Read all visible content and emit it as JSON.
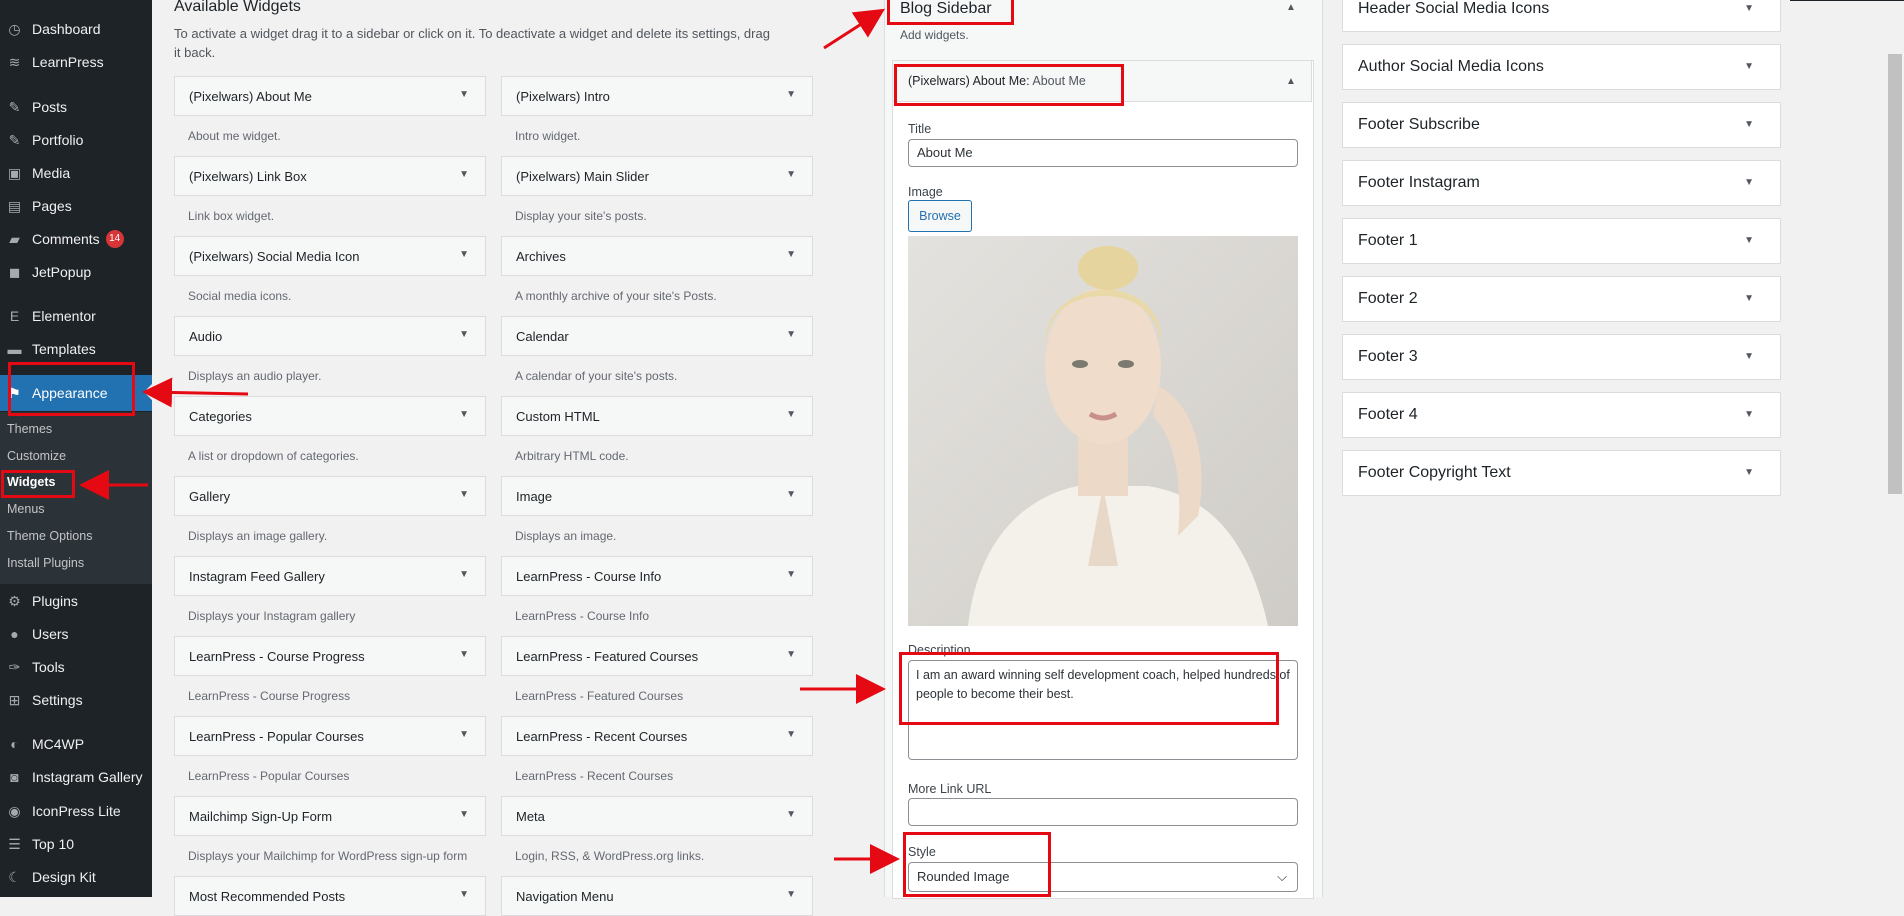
{
  "admin_menu": {
    "items": [
      {
        "label": "Dashboard",
        "icon": "dashboard-icon"
      },
      {
        "label": "LearnPress",
        "icon": "learnpress-icon"
      },
      {
        "label": "Posts",
        "icon": "pin-icon"
      },
      {
        "label": "Portfolio",
        "icon": "pin-icon"
      },
      {
        "label": "Media",
        "icon": "media-icon"
      },
      {
        "label": "Pages",
        "icon": "pages-icon"
      },
      {
        "label": "Comments",
        "icon": "comment-icon",
        "badge": "14"
      },
      {
        "label": "JetPopup",
        "icon": "jetpopup-icon"
      },
      {
        "label": "Elementor",
        "icon": "elementor-icon"
      },
      {
        "label": "Templates",
        "icon": "folder-icon"
      },
      {
        "label": "Appearance",
        "icon": "brush-icon",
        "current": true
      },
      {
        "label": "Plugins",
        "icon": "plugin-icon"
      },
      {
        "label": "Users",
        "icon": "users-icon"
      },
      {
        "label": "Tools",
        "icon": "wrench-icon"
      },
      {
        "label": "Settings",
        "icon": "settings-icon"
      },
      {
        "label": "MC4WP",
        "icon": "mc4wp-icon"
      },
      {
        "label": "Instagram Gallery",
        "icon": "camera-icon"
      },
      {
        "label": "IconPress Lite",
        "icon": "iconpress-icon"
      },
      {
        "label": "Top 10",
        "icon": "list-icon"
      },
      {
        "label": "Design Kit",
        "icon": "moon-icon"
      }
    ],
    "submenu": [
      {
        "label": "Themes"
      },
      {
        "label": "Customize"
      },
      {
        "label": "Widgets",
        "active": true
      },
      {
        "label": "Menus"
      },
      {
        "label": "Theme Options"
      },
      {
        "label": "Install Plugins"
      }
    ]
  },
  "available_widgets": {
    "title": "Available Widgets",
    "description": "To activate a widget drag it to a sidebar or click on it. To deactivate a widget and delete its settings, drag it back.",
    "widgets": [
      {
        "name": "(Pixelwars) About Me",
        "desc": "About me widget."
      },
      {
        "name": "(Pixelwars) Intro",
        "desc": "Intro widget."
      },
      {
        "name": "(Pixelwars) Link Box",
        "desc": "Link box widget."
      },
      {
        "name": "(Pixelwars) Main Slider",
        "desc": "Display your site's posts."
      },
      {
        "name": "(Pixelwars) Social Media Icon",
        "desc": "Social media icons."
      },
      {
        "name": "Archives",
        "desc": "A monthly archive of your site's Posts."
      },
      {
        "name": "Audio",
        "desc": "Displays an audio player."
      },
      {
        "name": "Calendar",
        "desc": "A calendar of your site's posts."
      },
      {
        "name": "Categories",
        "desc": "A list or dropdown of categories."
      },
      {
        "name": "Custom HTML",
        "desc": "Arbitrary HTML code."
      },
      {
        "name": "Gallery",
        "desc": "Displays an image gallery."
      },
      {
        "name": "Image",
        "desc": "Displays an image."
      },
      {
        "name": "Instagram Feed Gallery",
        "desc": "Displays your Instagram gallery"
      },
      {
        "name": "LearnPress - Course Info",
        "desc": "LearnPress - Course Info"
      },
      {
        "name": "LearnPress - Course Progress",
        "desc": "LearnPress - Course Progress"
      },
      {
        "name": "LearnPress - Featured Courses",
        "desc": "LearnPress - Featured Courses"
      },
      {
        "name": "LearnPress - Popular Courses",
        "desc": "LearnPress - Popular Courses"
      },
      {
        "name": "LearnPress - Recent Courses",
        "desc": "LearnPress - Recent Courses"
      },
      {
        "name": "Mailchimp Sign-Up Form",
        "desc": "Displays your Mailchimp for WordPress sign-up form"
      },
      {
        "name": "Meta",
        "desc": "Login, RSS, & WordPress.org links."
      },
      {
        "name": "Most Recommended Posts",
        "desc": ""
      },
      {
        "name": "Navigation Menu",
        "desc": ""
      }
    ]
  },
  "blog_sidebar": {
    "title": "Blog Sidebar",
    "subtitle": "Add widgets.",
    "widget": {
      "title_prefix": "(Pixelwars) About Me:",
      "title_instance": "About Me",
      "title_label": "Title",
      "title_value": "About Me",
      "image_label": "Image",
      "browse_label": "Browse",
      "description_label": "Description",
      "description_value": "I am an award winning self development coach, helped hundreds of people to become their best.",
      "more_link_label": "More Link URL",
      "more_link_value": "",
      "style_label": "Style",
      "style_value": "Rounded Image"
    }
  },
  "other_sidebars": [
    {
      "title": "Header Social Media Icons"
    },
    {
      "title": "Author Social Media Icons"
    },
    {
      "title": "Footer Subscribe"
    },
    {
      "title": "Footer Instagram"
    },
    {
      "title": "Footer 1"
    },
    {
      "title": "Footer 2"
    },
    {
      "title": "Footer 3"
    },
    {
      "title": "Footer 4"
    },
    {
      "title": "Footer Copyright Text"
    }
  ],
  "colors": {
    "admin_bg": "#1d2327",
    "accent": "#2271b1",
    "annotation_red": "#e50914",
    "badge_red": "#d63638"
  }
}
